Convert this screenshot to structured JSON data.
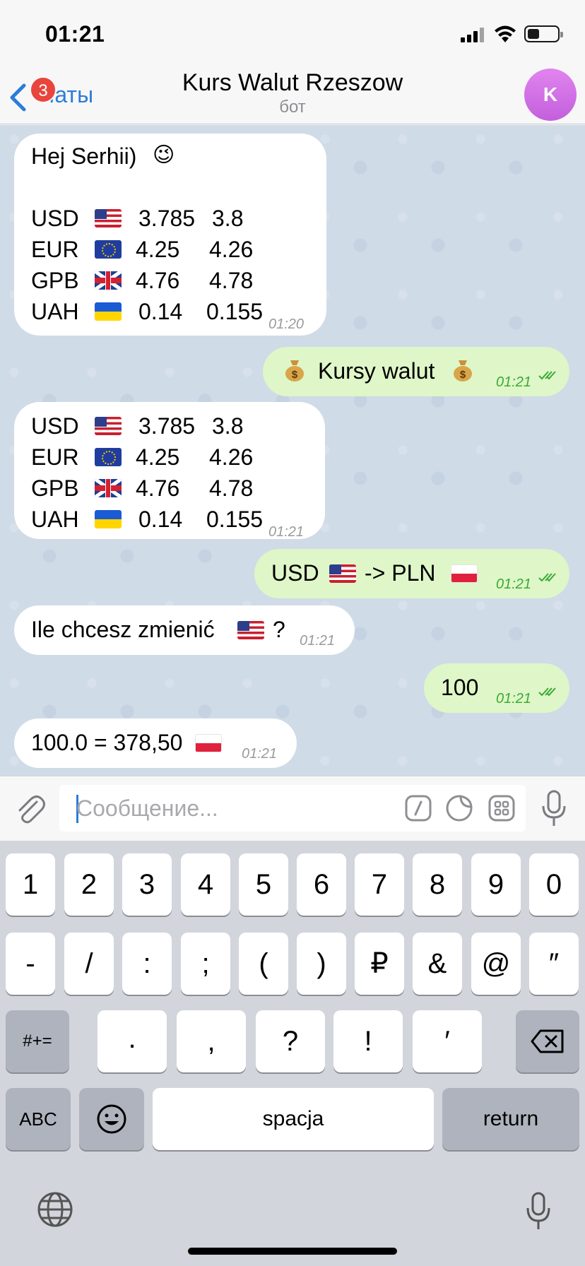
{
  "status": {
    "time": "01:21"
  },
  "nav": {
    "back_label": "Чаты",
    "badge": "3",
    "title": "Kurs Walut Rzeszow",
    "subtitle": "бот",
    "avatar_letter": "K"
  },
  "messages": {
    "m1": {
      "greeting": "Hej Serhii)",
      "greeting_emoji": "😉",
      "time": "01:20",
      "rates": [
        {
          "code": "USD",
          "flag": "us",
          "buy": "3.785",
          "sell": "3.8"
        },
        {
          "code": "EUR",
          "flag": "eu",
          "buy": "4.25",
          "sell": "4.26"
        },
        {
          "code": "GPB",
          "flag": "uk",
          "buy": "4.76",
          "sell": "4.78"
        },
        {
          "code": "UAH",
          "flag": "ua",
          "buy": "0.14",
          "sell": "0.155"
        }
      ]
    },
    "m2": {
      "text": "Kursy walut",
      "time": "01:21"
    },
    "m3": {
      "time": "01:21",
      "rates": [
        {
          "code": "USD",
          "flag": "us",
          "buy": "3.785",
          "sell": "3.8"
        },
        {
          "code": "EUR",
          "flag": "eu",
          "buy": "4.25",
          "sell": "4.26"
        },
        {
          "code": "GPB",
          "flag": "uk",
          "buy": "4.76",
          "sell": "4.78"
        },
        {
          "code": "UAH",
          "flag": "ua",
          "buy": "0.14",
          "sell": "0.155"
        }
      ]
    },
    "m4": {
      "from": "USD",
      "arrow": "-> PLN",
      "time": "01:21"
    },
    "m5": {
      "text": "Ile chcesz zmienić",
      "suffix": "?",
      "time": "01:21"
    },
    "m6": {
      "text": "100",
      "time": "01:21"
    },
    "m7": {
      "text": "100.0 = 378,50",
      "time": "01:21"
    }
  },
  "input": {
    "placeholder": "Сообщение..."
  },
  "keyboard": {
    "row1": [
      "1",
      "2",
      "3",
      "4",
      "5",
      "6",
      "7",
      "8",
      "9",
      "0"
    ],
    "row2": [
      "-",
      "/",
      ":",
      ";",
      "(",
      ")",
      "₽",
      "&",
      "@",
      "″"
    ],
    "row3": [
      ".",
      ",",
      "?",
      "!",
      "′"
    ],
    "symbols_key": "#+=",
    "abc_key": "ABC",
    "space_key": "spacja",
    "return_key": "return"
  },
  "colors": {
    "accent": "#2c7cd8",
    "outgoing": "#dff6c8",
    "badge": "#e8453c",
    "avatar": "#d070e6"
  }
}
